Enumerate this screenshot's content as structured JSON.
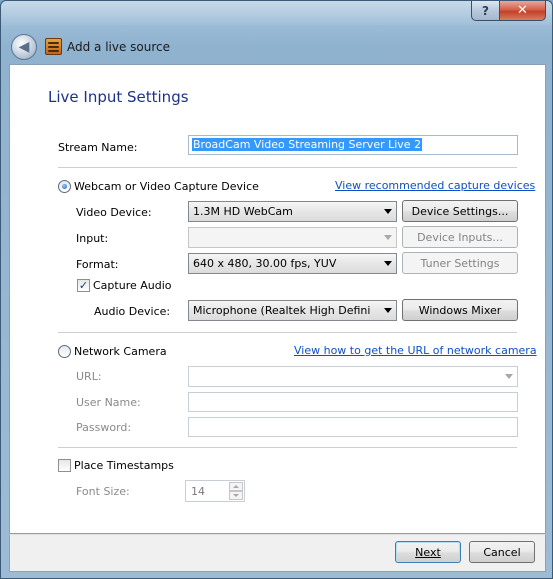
{
  "window": {
    "title": "Add a live source",
    "help_glyph": "?",
    "close_glyph": "✕",
    "back_glyph": "◀"
  },
  "page_title": "Live Input Settings",
  "stream_name": {
    "label": "Stream Name:",
    "value": "BroadCam Video Streaming Server Live 2"
  },
  "webcam": {
    "option_label": "Webcam or Video Capture Device",
    "selected": true,
    "recommended_link": "View recommended capture devices",
    "video_device": {
      "label": "Video Device:",
      "value": "1.3M HD WebCam",
      "button": "Device Settings..."
    },
    "input": {
      "label": "Input:",
      "value": "",
      "button": "Device Inputs..."
    },
    "format": {
      "label": "Format:",
      "value": "640 x 480, 30.00 fps, YUV",
      "button": "Tuner Settings"
    },
    "capture_audio": {
      "label": "Capture Audio",
      "checked": true,
      "check_glyph": "✓"
    },
    "audio_device": {
      "label": "Audio Device:",
      "value": "Microphone (Realtek High Defini",
      "button": "Windows Mixer"
    }
  },
  "network_camera": {
    "option_label": "Network Camera",
    "selected": false,
    "help_link": "View how to get the URL of network camera",
    "url": {
      "label": "URL:",
      "value": ""
    },
    "username": {
      "label": "User Name:",
      "value": ""
    },
    "password": {
      "label": "Password:",
      "value": ""
    }
  },
  "timestamps": {
    "label": "Place Timestamps",
    "checked": false,
    "font_size_label": "Font Size:",
    "font_size_value": "14"
  },
  "footer": {
    "next_label": "Next",
    "cancel_label": "Cancel"
  }
}
